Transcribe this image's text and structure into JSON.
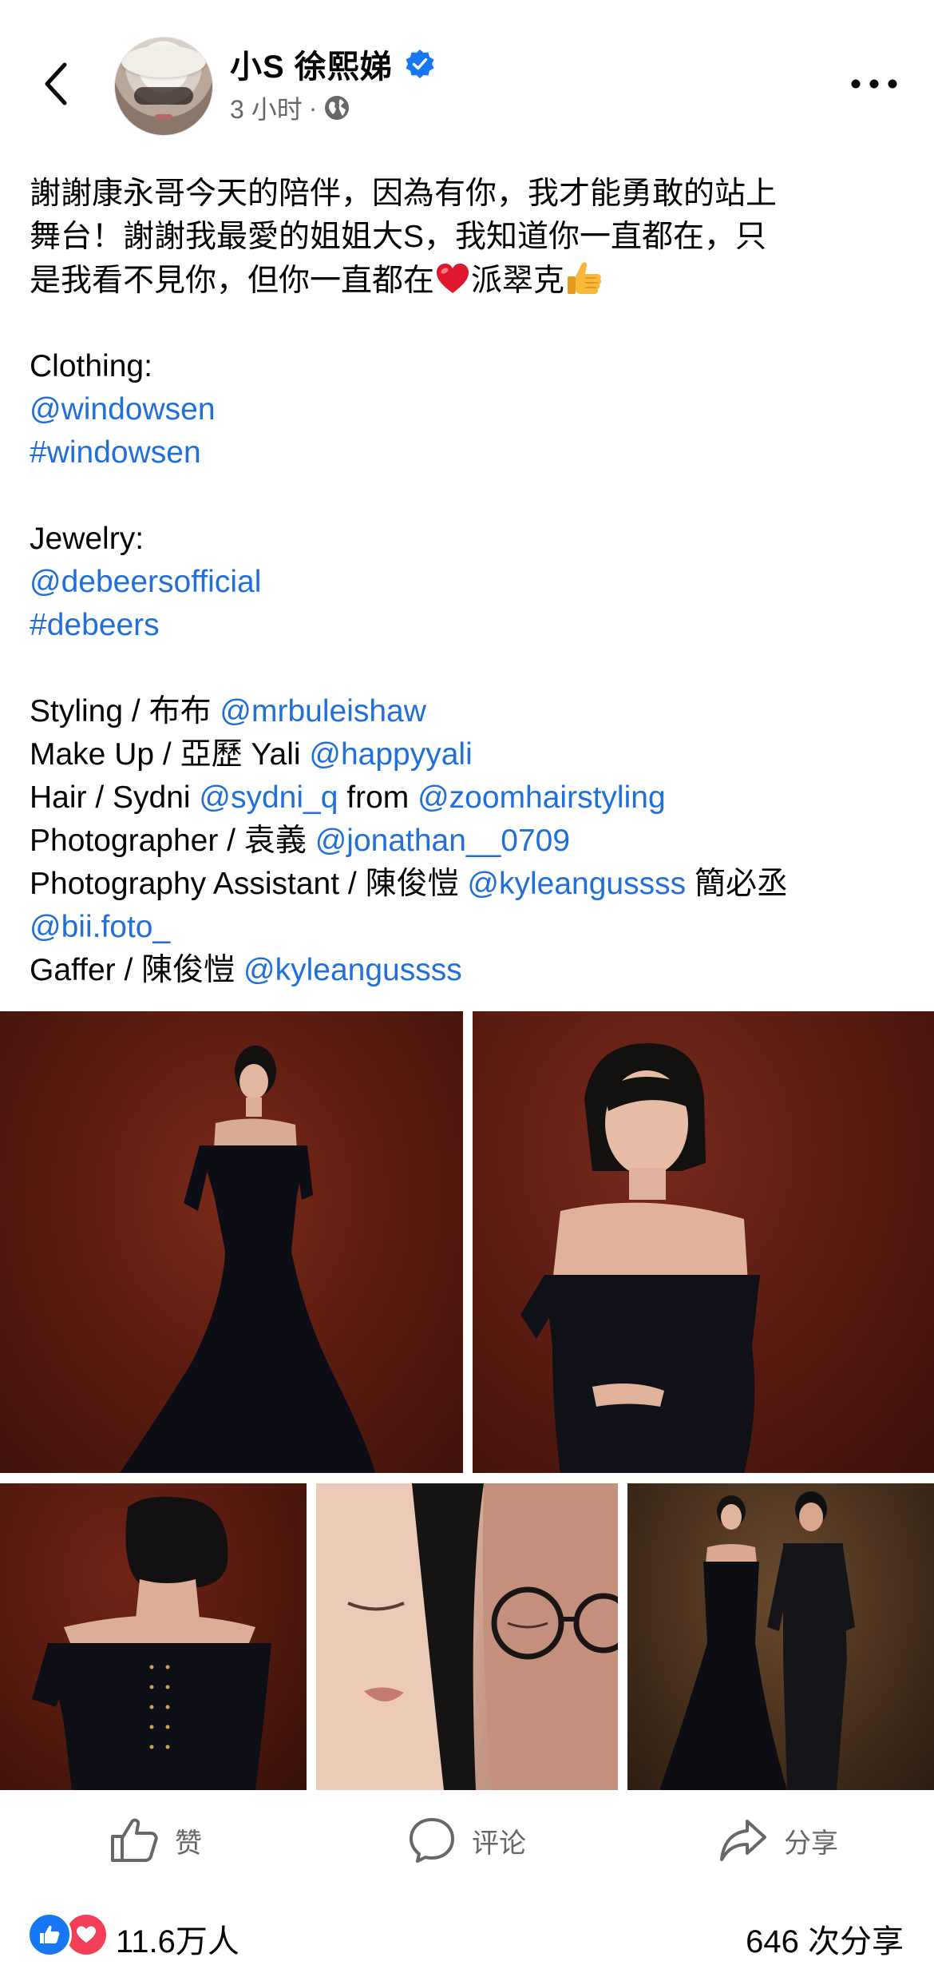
{
  "header": {
    "author_name": "小S 徐熙娣",
    "timestamp": "3 小时",
    "separator": "·",
    "privacy_icon": "globe-icon",
    "verified_icon": "verified-badge-icon",
    "back_icon": "chevron-left-icon",
    "more_icon": "more-dots-icon"
  },
  "post": {
    "intro_line1": "謝謝康永哥今天的陪伴，因為有你，我才能勇敢的站上",
    "intro_line2": "舞台！謝謝我最愛的姐姐大S，我知道你一直都在，只",
    "intro_line3_a": "是我看不見你，但你一直都在",
    "intro_line3_b": "派翠克",
    "clothing_label": "Clothing:",
    "clothing_mention": "@windowsen",
    "clothing_hashtag": "#windowsen",
    "jewelry_label": "Jewelry:",
    "jewelry_mention": "@debeersofficial",
    "jewelry_hashtag": "#debeers",
    "styling_label": "Styling / 布布 ",
    "styling_mention": "@mrbuleishaw",
    "makeup_label": "Make Up /  亞歷 Yali ",
    "makeup_mention": "@happyyali",
    "hair_label": "Hair / Sydni ",
    "hair_mention": "@sydni_q",
    "hair_from": " from ",
    "hair_mention2": "@zoomhairstyling",
    "photographer_label": "Photographer / 袁義 ",
    "photographer_mention": "@jonathan__0709",
    "assistant_label": "Photography Assistant / 陳俊愷 ",
    "assistant_mention": "@kyleangussss",
    "assistant_mid": " 簡必丞 ",
    "assistant_mention2": "@bii.foto_",
    "gaffer_label": "Gaffer  / 陳俊愷 ",
    "gaffer_mention": "@kyleangussss",
    "emojis": [
      "red-heart-emoji",
      "thumbs-up-emoji"
    ]
  },
  "actions": {
    "like_label": "赞",
    "comment_label": "评论",
    "share_label": "分享"
  },
  "stats": {
    "reactions": "11.6万人",
    "shares": "646 次分享"
  },
  "colors": {
    "link": "#216fdb",
    "verified": "#1877f2",
    "like": "#1877f2",
    "love": "#f33e58",
    "muted": "#65676b"
  }
}
